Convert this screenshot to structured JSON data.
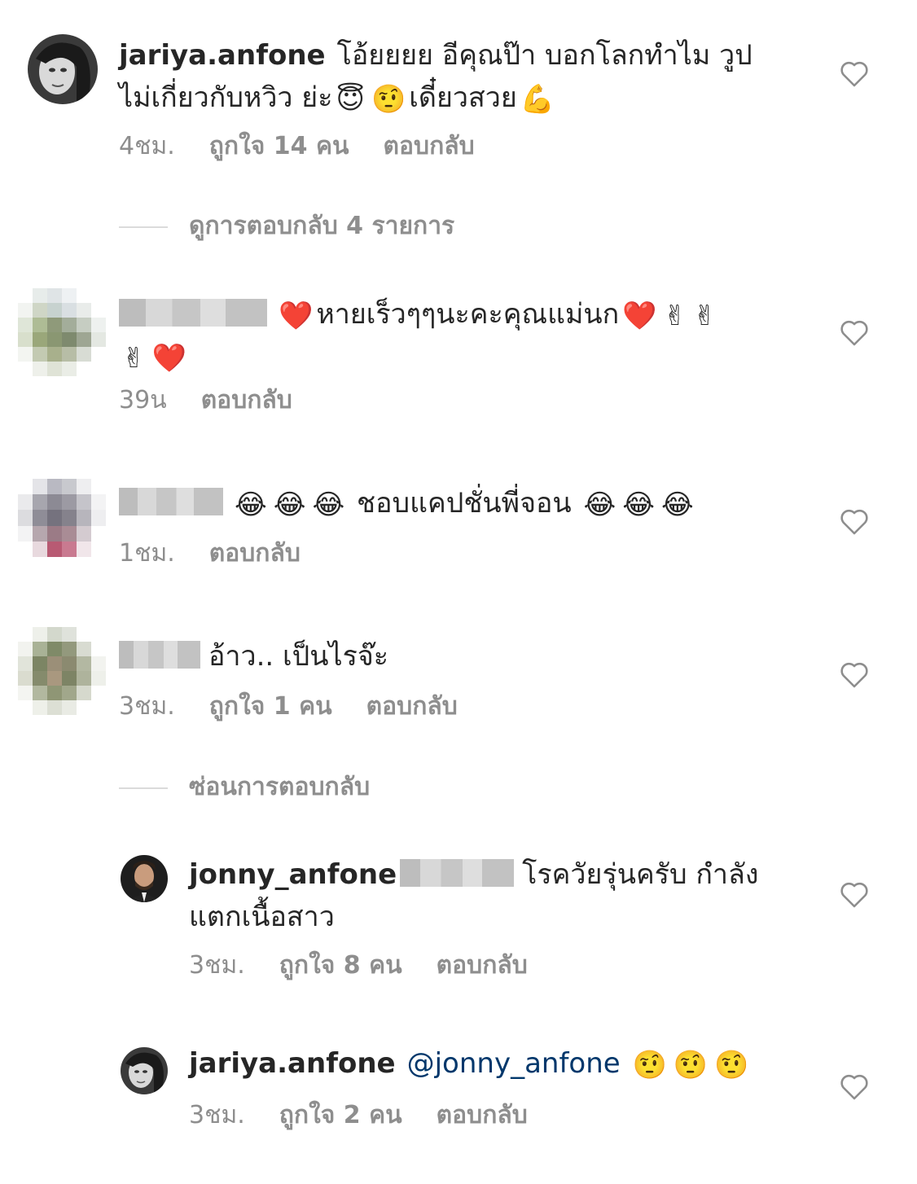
{
  "comments": [
    {
      "username": "jariya.anfone",
      "text_line1": "โอ้ยยยย  อีคุณป๊า  บอกโลกทำไม  วูป",
      "text_line2a": "ไม่เกี่ยวกับหวิว  ย่ะ",
      "text_line2b": "เดี๋ยวสวย",
      "emoji_halo": "😇",
      "emoji_raised": "🤨",
      "emoji_muscle": "💪",
      "time": "4ชม.",
      "likes": "ถูกใจ 14 คน",
      "reply": "ตอบกลับ",
      "view_replies": "ดูการตอบกลับ 4 รายการ"
    },
    {
      "username_hidden": true,
      "heart": "❤️",
      "text": "หายเร็วๆๆนะคะคุณแม่นก",
      "victory": "✌",
      "time": "39น",
      "reply": "ตอบกลับ"
    },
    {
      "username_hidden": true,
      "laugh": "😂",
      "text": "ชอบแคปชั่นพี่จอน",
      "time": "1ชม.",
      "reply": "ตอบกลับ"
    },
    {
      "username_hidden": true,
      "text": "อ้าว.. เป็นไรจ๊ะ",
      "time": "3ชม.",
      "likes": "ถูกใจ 1 คน",
      "reply": "ตอบกลับ",
      "hide_replies": "ซ่อนการตอบกลับ"
    }
  ],
  "replies": [
    {
      "username": "jonny_anfone",
      "text_line1": "โรควัยรุ่นครับ กำลัง",
      "text_line2": "แตกเนื้อสาว",
      "time": "3ชม.",
      "likes": "ถูกใจ 8 คน",
      "reply": "ตอบกลับ"
    },
    {
      "username": "jariya.anfone",
      "mention": "@jonny_anfone",
      "emoji_raised": "🤨",
      "time": "3ชม.",
      "likes": "ถูกใจ 2 คน",
      "reply": "ตอบกลับ"
    }
  ],
  "icons": {
    "like": "heart-outline-icon"
  },
  "colors": {
    "text": "#262626",
    "meta": "#8e8e8e",
    "mention": "#00376b",
    "divider": "#dbdbdb"
  }
}
